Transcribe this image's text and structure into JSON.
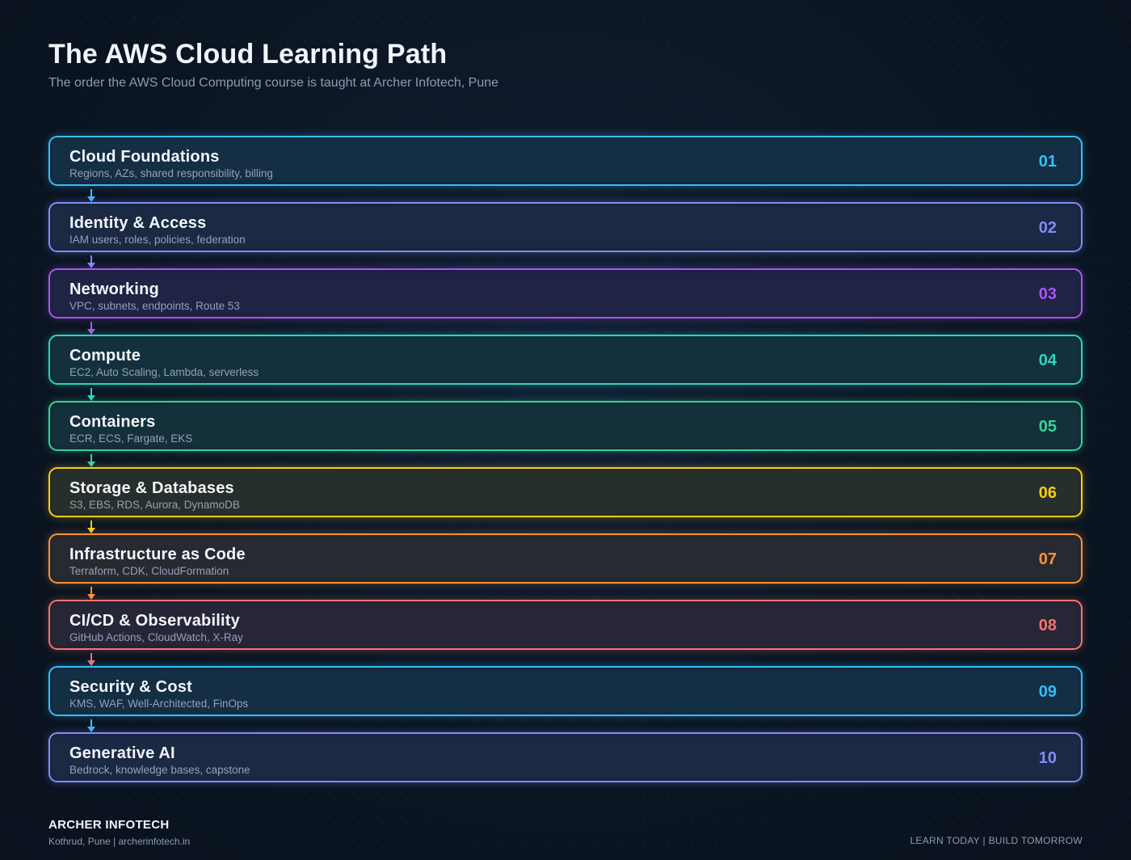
{
  "header": {
    "title": "The AWS Cloud Learning Path",
    "subtitle": "The order the AWS Cloud Computing course is taught at Archer Infotech, Pune"
  },
  "steps": [
    {
      "number": "01",
      "title": "Cloud Foundations",
      "description": "Regions, AZs, shared responsibility, billing",
      "color": "#38bdf8"
    },
    {
      "number": "02",
      "title": "Identity & Access",
      "description": "IAM users, roles, policies, federation",
      "color": "#818cf8"
    },
    {
      "number": "03",
      "title": "Networking",
      "description": "VPC, subnets, endpoints, Route 53",
      "color": "#a855f7"
    },
    {
      "number": "04",
      "title": "Compute",
      "description": "EC2, Auto Scaling, Lambda, serverless",
      "color": "#2dd4bf"
    },
    {
      "number": "05",
      "title": "Containers",
      "description": "ECR, ECS, Fargate, EKS",
      "color": "#34d399"
    },
    {
      "number": "06",
      "title": "Storage & Databases",
      "description": "S3, EBS, RDS, Aurora, DynamoDB",
      "color": "#facc15"
    },
    {
      "number": "07",
      "title": "Infrastructure as Code",
      "description": "Terraform, CDK, CloudFormation",
      "color": "#fb923c"
    },
    {
      "number": "08",
      "title": "CI/CD & Observability",
      "description": "GitHub Actions, CloudWatch, X-Ray",
      "color": "#f87171"
    },
    {
      "number": "09",
      "title": "Security & Cost",
      "description": "KMS, WAF, Well-Architected, FinOps",
      "color": "#38bdf8"
    },
    {
      "number": "10",
      "title": "Generative AI",
      "description": "Bedrock, knowledge bases, capstone",
      "color": "#818cf8"
    }
  ],
  "footer": {
    "brand": "ARCHER INFOTECH",
    "location": "Kothrud, Pune  |  archerinfotech.in",
    "tagline": "LEARN TODAY  |  BUILD TOMORROW"
  }
}
